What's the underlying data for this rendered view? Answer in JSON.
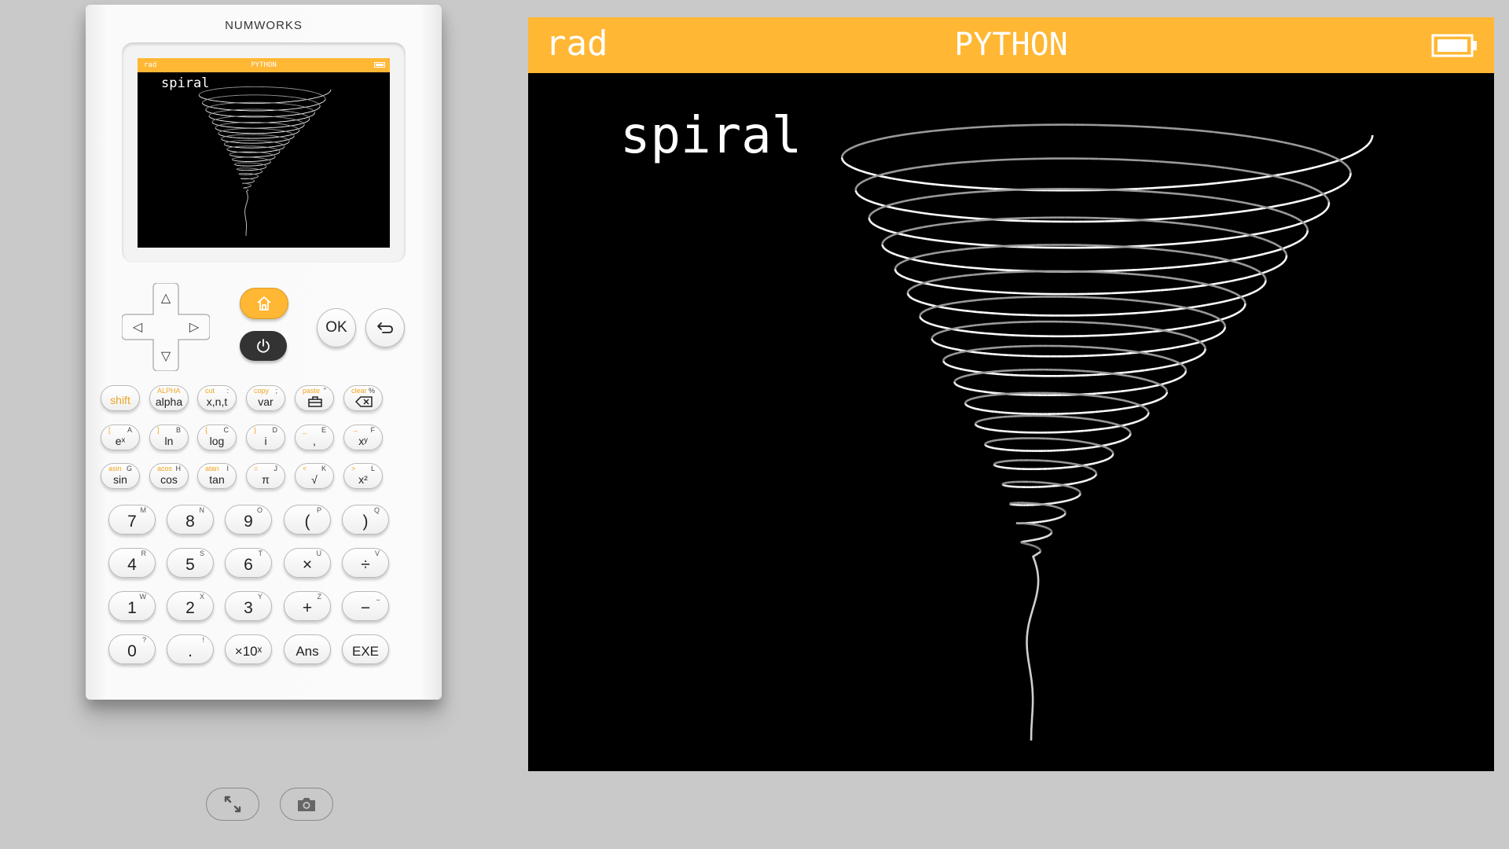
{
  "calculator": {
    "brand": "NUMWORKS",
    "screen": {
      "angle_mode": "rad",
      "app": "PYTHON",
      "title": "spiral"
    },
    "nav": {
      "up": "△",
      "down": "▽",
      "left": "◁",
      "right": "▷",
      "ok": "OK"
    },
    "function_keys": [
      {
        "name": "shift-key",
        "main": "shift",
        "alt": "",
        "alpha": "",
        "main_orange": true
      },
      {
        "name": "alpha-key",
        "main": "alpha",
        "alt": "ALPHA",
        "alpha": ""
      },
      {
        "name": "xnt-key",
        "main": "x,n,t",
        "alt": "cut",
        "alpha": ":"
      },
      {
        "name": "var-key",
        "main": "var",
        "alt": "copy",
        "alpha": ";"
      },
      {
        "name": "toolbox-key",
        "main": "",
        "alt": "paste",
        "alpha": "\""
      },
      {
        "name": "backspace-key",
        "main": "",
        "alt": "clear",
        "alpha": "%"
      },
      {
        "name": "exp-key",
        "main": "eˣ",
        "alt": "[",
        "alpha": "A"
      },
      {
        "name": "ln-key",
        "main": "ln",
        "alt": "]",
        "alpha": "B"
      },
      {
        "name": "log-key",
        "main": "log",
        "alt": "{",
        "alpha": "C"
      },
      {
        "name": "i-key",
        "main": "i",
        "alt": "}",
        "alpha": "D"
      },
      {
        "name": "comma-key",
        "main": ",",
        "alt": "_",
        "alpha": "E"
      },
      {
        "name": "power-key",
        "main": "xʸ",
        "alt": "→",
        "alpha": "F"
      },
      {
        "name": "sin-key",
        "main": "sin",
        "alt": "asin",
        "alpha": "G"
      },
      {
        "name": "cos-key",
        "main": "cos",
        "alt": "acos",
        "alpha": "H"
      },
      {
        "name": "tan-key",
        "main": "tan",
        "alt": "atan",
        "alpha": "I"
      },
      {
        "name": "pi-key",
        "main": "π",
        "alt": "=",
        "alpha": "J"
      },
      {
        "name": "sqrt-key",
        "main": "√",
        "alt": "<",
        "alpha": "K"
      },
      {
        "name": "square-key",
        "main": "x²",
        "alt": ">",
        "alpha": "L"
      }
    ],
    "number_keys": [
      {
        "name": "key-7",
        "main": "7",
        "alpha": "M"
      },
      {
        "name": "key-8",
        "main": "8",
        "alpha": "N"
      },
      {
        "name": "key-9",
        "main": "9",
        "alpha": "O"
      },
      {
        "name": "key-lparen",
        "main": "(",
        "alpha": "P"
      },
      {
        "name": "key-rparen",
        "main": ")",
        "alpha": "Q"
      },
      {
        "name": "key-4",
        "main": "4",
        "alpha": "R"
      },
      {
        "name": "key-5",
        "main": "5",
        "alpha": "S"
      },
      {
        "name": "key-6",
        "main": "6",
        "alpha": "T"
      },
      {
        "name": "key-multiply",
        "main": "×",
        "alpha": "U"
      },
      {
        "name": "key-divide",
        "main": "÷",
        "alpha": "V"
      },
      {
        "name": "key-1",
        "main": "1",
        "alpha": "W"
      },
      {
        "name": "key-2",
        "main": "2",
        "alpha": "X"
      },
      {
        "name": "key-3",
        "main": "3",
        "alpha": "Y"
      },
      {
        "name": "key-plus",
        "main": "+",
        "alpha": "Z"
      },
      {
        "name": "key-minus",
        "main": "−",
        "alpha": "⎵"
      },
      {
        "name": "key-0",
        "main": "0",
        "alpha": "?"
      },
      {
        "name": "key-dot",
        "main": ".",
        "alpha": "!"
      },
      {
        "name": "key-x10",
        "main": "×10ˣ",
        "alpha": "",
        "small": true
      },
      {
        "name": "key-ans",
        "main": "Ans",
        "alpha": "",
        "small": true
      },
      {
        "name": "key-exe",
        "main": "EXE",
        "alpha": "",
        "small": true
      }
    ]
  },
  "toolbar": {
    "fullscreen_icon": "fullscreen-icon",
    "screenshot_icon": "camera-icon"
  },
  "big_screen": {
    "angle_mode": "rad",
    "app": "PYTHON",
    "title": "spiral"
  },
  "colors": {
    "accent": "#ffb734",
    "background": "#c9c9c9",
    "screen_bg": "#000000"
  }
}
